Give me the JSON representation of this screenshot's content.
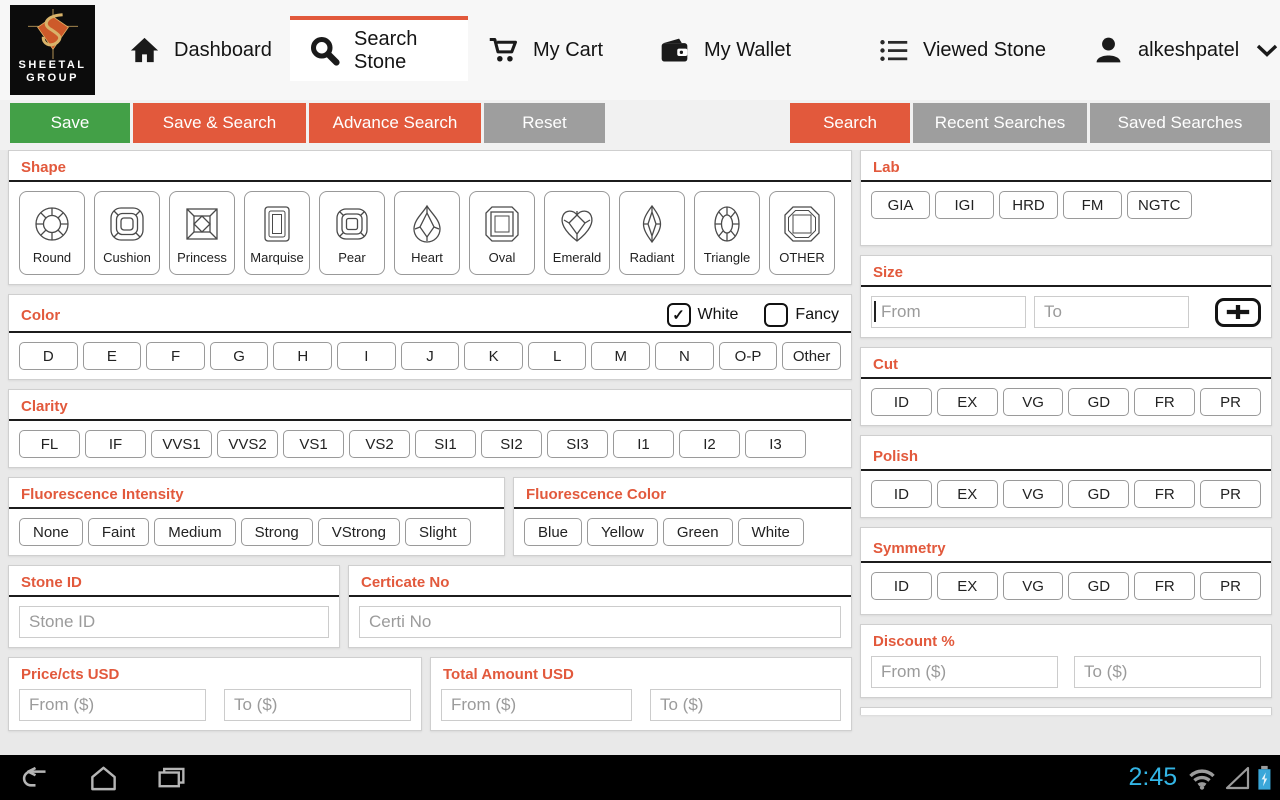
{
  "header": {
    "logo": {
      "line1": "SHEETAL",
      "line2": "GROUP"
    },
    "nav": [
      {
        "label": "Dashboard",
        "icon": "home-icon",
        "active": false
      },
      {
        "label": "Search Stone",
        "icon": "search-icon",
        "active": true
      },
      {
        "label": "My Cart",
        "icon": "cart-icon",
        "active": false
      },
      {
        "label": "My Wallet",
        "icon": "wallet-icon",
        "active": false
      },
      {
        "label": "Viewed Stone",
        "icon": "list-icon",
        "active": false
      },
      {
        "label": "alkeshpatel",
        "icon": "user-icon",
        "active": false,
        "chevron": true
      }
    ]
  },
  "toolbar": {
    "left": [
      {
        "label": "Save",
        "style": "green"
      },
      {
        "label": "Save & Search",
        "style": "orange"
      },
      {
        "label": "Advance Search",
        "style": "orange"
      },
      {
        "label": "Reset",
        "style": "gray"
      }
    ],
    "right": [
      {
        "label": "Search",
        "style": "orange"
      },
      {
        "label": "Recent Searches",
        "style": "gray"
      },
      {
        "label": "Saved Searches",
        "style": "gray"
      }
    ]
  },
  "sections": {
    "shape": {
      "title": "Shape",
      "items": [
        {
          "label": "Round",
          "icon": "round-shape-icon"
        },
        {
          "label": "Cushion",
          "icon": "cushion-shape-icon"
        },
        {
          "label": "Princess",
          "icon": "princess-shape-icon"
        },
        {
          "label": "Marquise",
          "icon": "marquise-shape-icon"
        },
        {
          "label": "Pear",
          "icon": "pear-shape-icon"
        },
        {
          "label": "Heart",
          "icon": "heart-shape-icon"
        },
        {
          "label": "Oval",
          "icon": "oval-shape-icon"
        },
        {
          "label": "Emerald",
          "icon": "emerald-shape-icon"
        },
        {
          "label": "Radiant",
          "icon": "radiant-shape-icon"
        },
        {
          "label": "Triangle",
          "icon": "triangle-shape-icon"
        },
        {
          "label": "OTHER",
          "icon": "other-shape-icon"
        }
      ]
    },
    "color": {
      "title": "Color",
      "checkboxes": [
        {
          "label": "White",
          "checked": true
        },
        {
          "label": "Fancy",
          "checked": false
        }
      ],
      "options": [
        "D",
        "E",
        "F",
        "G",
        "H",
        "I",
        "J",
        "K",
        "L",
        "M",
        "N",
        "O-P",
        "Other"
      ]
    },
    "clarity": {
      "title": "Clarity",
      "options": [
        "FL",
        "IF",
        "VVS1",
        "VVS2",
        "VS1",
        "VS2",
        "SI1",
        "SI2",
        "SI3",
        "I1",
        "I2",
        "I3"
      ]
    },
    "fluor_intensity": {
      "title": "Fluorescence Intensity",
      "options": [
        "None",
        "Faint",
        "Medium",
        "Strong",
        "VStrong",
        "Slight"
      ]
    },
    "fluor_color": {
      "title": "Fluorescence Color",
      "options": [
        "Blue",
        "Yellow",
        "Green",
        "White"
      ]
    },
    "stone_id": {
      "title": "Stone ID",
      "placeholder": "Stone ID"
    },
    "certificate": {
      "title": "Certicate No",
      "placeholder": "Certi No"
    },
    "price": {
      "title": "Price/cts USD",
      "from_placeholder": "From ($)",
      "to_placeholder": "To ($)"
    },
    "total": {
      "title": "Total Amount USD",
      "from_placeholder": "From ($)",
      "to_placeholder": "To ($)"
    },
    "lab": {
      "title": "Lab",
      "options": [
        "GIA",
        "IGI",
        "HRD",
        "FM",
        "NGTC"
      ]
    },
    "size": {
      "title": "Size",
      "from_placeholder": "From",
      "to_placeholder": "To"
    },
    "cut": {
      "title": "Cut",
      "options": [
        "ID",
        "EX",
        "VG",
        "GD",
        "FR",
        "PR"
      ]
    },
    "polish": {
      "title": "Polish",
      "options": [
        "ID",
        "EX",
        "VG",
        "GD",
        "FR",
        "PR"
      ]
    },
    "symmetry": {
      "title": "Symmetry",
      "options": [
        "ID",
        "EX",
        "VG",
        "GD",
        "FR",
        "PR"
      ]
    },
    "discount": {
      "title": "Discount %",
      "from_placeholder": "From ($)",
      "to_placeholder": "To ($)"
    }
  },
  "navbar": {
    "time": "2:45",
    "status_icons": [
      "wifi-icon",
      "signal-icon",
      "battery-charging-icon"
    ]
  },
  "colors": {
    "accent_orange": "#e2593c",
    "save_green": "#43a047",
    "button_gray": "#9e9e9e",
    "time_blue": "#33b5e5"
  }
}
